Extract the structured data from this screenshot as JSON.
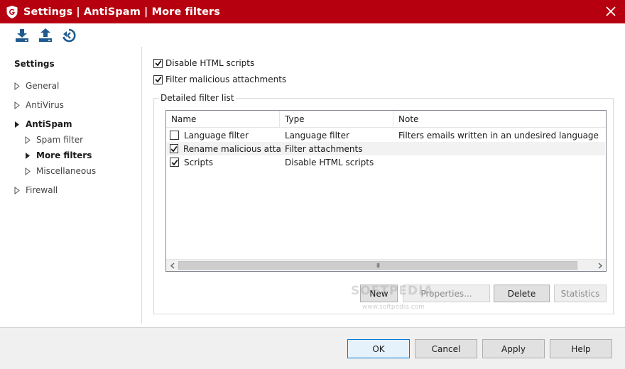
{
  "window": {
    "title": "Settings | AntiSpam | More filters",
    "accent_color": "#b7000f",
    "icons": [
      "gdata-logo-icon",
      "close-icon"
    ]
  },
  "toolbar": {
    "icons": [
      "import-icon",
      "export-icon",
      "restore-defaults-icon"
    ]
  },
  "sidebar": {
    "heading": "Settings",
    "items": [
      {
        "label": "General",
        "level": 0,
        "expanded": false,
        "selected": false
      },
      {
        "label": "AntiVirus",
        "level": 0,
        "expanded": false,
        "selected": false
      },
      {
        "label": "AntiSpam",
        "level": 0,
        "expanded": true,
        "selected": false
      },
      {
        "label": "Spam filter",
        "level": 1,
        "expanded": false,
        "selected": false
      },
      {
        "label": "More filters",
        "level": 1,
        "expanded": false,
        "selected": true
      },
      {
        "label": "Miscellaneous",
        "level": 1,
        "expanded": false,
        "selected": false
      },
      {
        "label": "Firewall",
        "level": 0,
        "expanded": false,
        "selected": false
      }
    ]
  },
  "options": {
    "disable_html_scripts": {
      "label": "Disable HTML scripts",
      "checked": true
    },
    "filter_malicious_attachments": {
      "label": "Filter malicious attachments",
      "checked": true
    }
  },
  "filter_list": {
    "group_label": "Detailed filter list",
    "columns": [
      "Name",
      "Type",
      "Note"
    ],
    "rows": [
      {
        "name": "Language filter",
        "type": "Language filter",
        "note": "Filters emails written in an undesired language",
        "checked": false
      },
      {
        "name": "Rename malicious attac...",
        "type": "Filter attachments",
        "note": "",
        "checked": true
      },
      {
        "name": "Scripts",
        "type": "Disable HTML scripts",
        "note": "",
        "checked": true
      }
    ],
    "scroll_grip": "III"
  },
  "list_buttons": {
    "new": "New",
    "properties": "Properties...",
    "delete": "Delete",
    "statistics": "Statistics"
  },
  "footer": {
    "ok": "OK",
    "cancel": "Cancel",
    "apply": "Apply",
    "help": "Help"
  },
  "watermark": {
    "text": "SOFTPEDIA",
    "url": "www.softpedia.com"
  }
}
